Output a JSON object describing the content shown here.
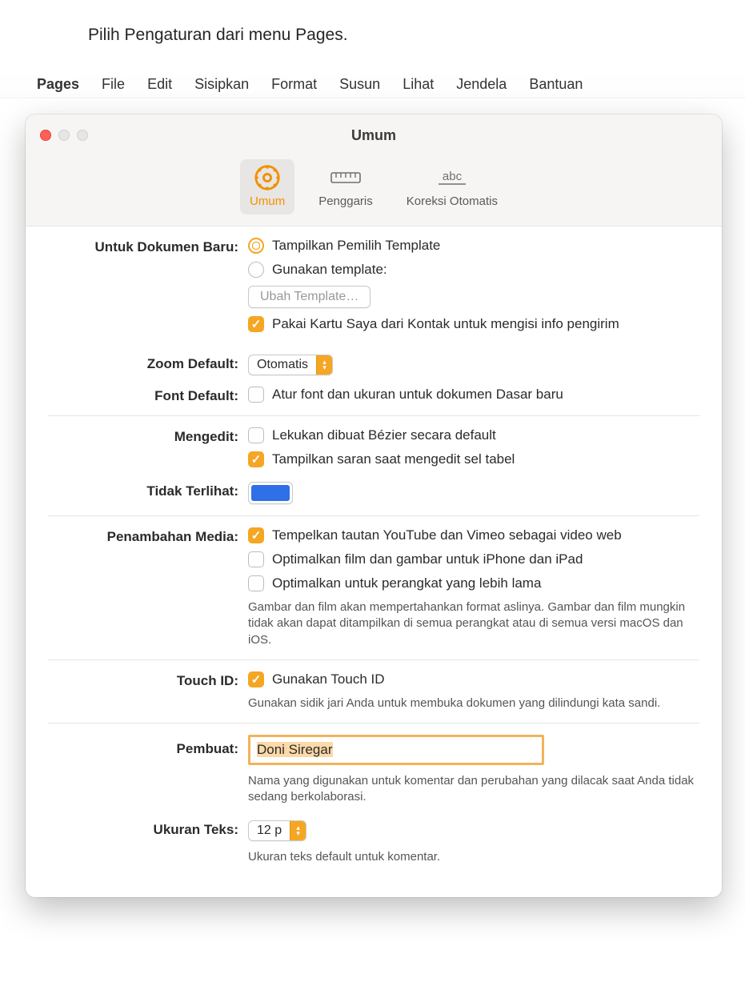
{
  "callout": "Pilih Pengaturan dari menu Pages.",
  "menubar": [
    "Pages",
    "File",
    "Edit",
    "Sisipkan",
    "Format",
    "Susun",
    "Lihat",
    "Jendela",
    "Bantuan"
  ],
  "window": {
    "title": "Umum",
    "tabs": [
      {
        "label": "Umum"
      },
      {
        "label": "Penggaris"
      },
      {
        "label": "Koreksi Otomatis"
      }
    ]
  },
  "prefs": {
    "newdoc": {
      "label": "Untuk Dokumen Baru:",
      "opt1": "Tampilkan Pemilih Template",
      "opt2": "Gunakan template:",
      "changeBtn": "Ubah Template…",
      "useCard": "Pakai Kartu Saya dari Kontak untuk mengisi info pengirim"
    },
    "zoom": {
      "label": "Zoom Default:",
      "value": "Otomatis"
    },
    "font": {
      "label": "Font Default:",
      "text": "Atur font dan ukuran untuk dokumen Dasar baru"
    },
    "edit": {
      "label": "Mengedit:",
      "bezier": "Lekukan dibuat Bézier secara default",
      "suggest": "Tampilkan saran saat mengedit sel tabel"
    },
    "invisible": {
      "label": "Tidak Terlihat:",
      "color": "#2f6fe8"
    },
    "media": {
      "label": "Penambahan Media:",
      "paste": "Tempelkan tautan YouTube dan Vimeo sebagai video web",
      "opt1": "Optimalkan film dan gambar untuk iPhone dan iPad",
      "opt2": "Optimalkan untuk perangkat yang lebih lama",
      "desc": "Gambar dan film akan mempertahankan format aslinya. Gambar dan film mungkin tidak akan dapat ditampilkan di semua perangkat atau di semua versi macOS dan iOS."
    },
    "touchid": {
      "label": "Touch ID:",
      "text": "Gunakan Touch ID",
      "desc": "Gunakan sidik jari Anda untuk membuka dokumen yang dilindungi kata sandi."
    },
    "author": {
      "label": "Pembuat:",
      "value": "Doni Siregar",
      "desc": "Nama yang digunakan untuk komentar dan perubahan yang dilacak saat Anda tidak sedang berkolaborasi."
    },
    "textsize": {
      "label": "Ukuran Teks:",
      "value": "12 p",
      "desc": "Ukuran teks default untuk komentar."
    }
  }
}
